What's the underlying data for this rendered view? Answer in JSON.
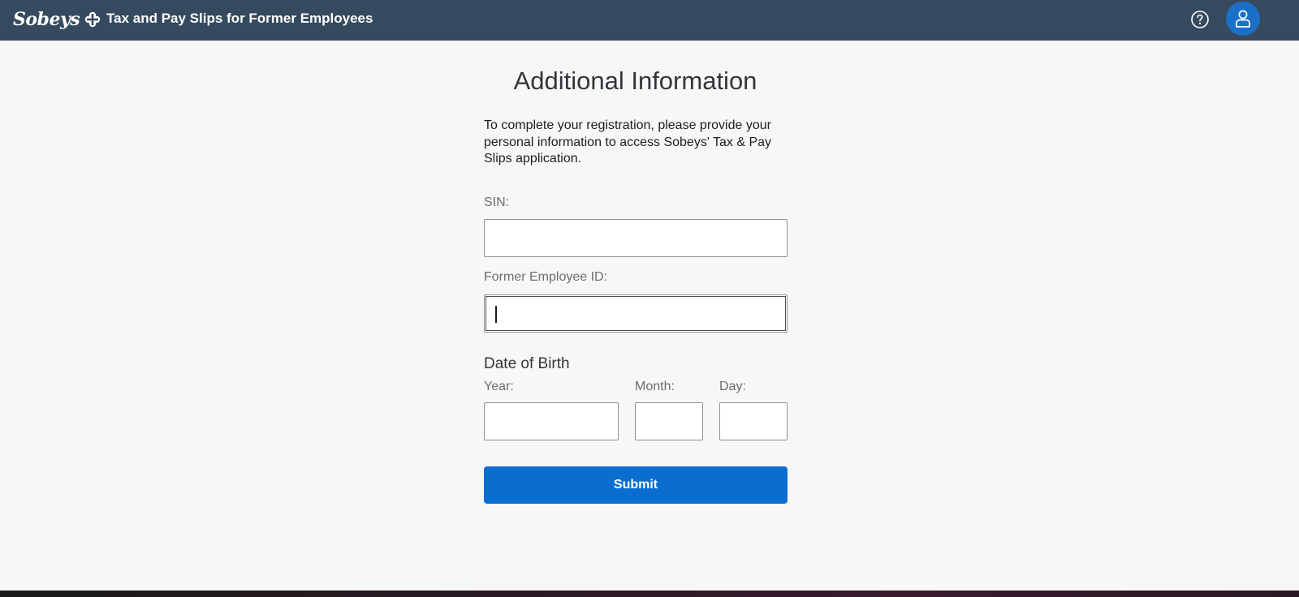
{
  "header": {
    "logo_text": "Sobeys",
    "title": "Tax and Pay Slips for Former Employees",
    "help_icon": "question-circle-icon",
    "user_icon": "user-icon",
    "brand_color": "#354a5f"
  },
  "form": {
    "title": "Additional Information",
    "intro": "To complete your registration, please provide your personal information to access Sobeys' Tax & Pay Slips application.",
    "sin_label": "SIN:",
    "sin_value": "",
    "employee_id_label": "Former Employee ID:",
    "employee_id_value": "",
    "dob_title": "Date of Birth",
    "year_label": "Year:",
    "year_value": "",
    "month_label": "Month:",
    "month_value": "",
    "day_label": "Day:",
    "day_value": "",
    "submit_label": "Submit",
    "accent_color": "#0a6ed1"
  }
}
